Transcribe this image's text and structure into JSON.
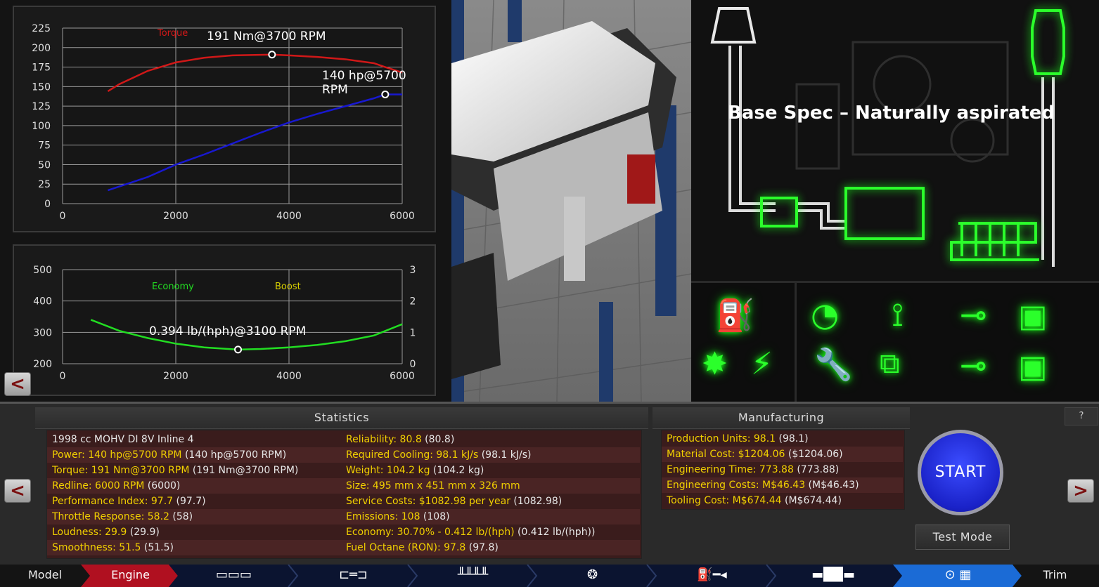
{
  "torque_power_chart": {
    "y_ticks": [
      "225",
      "200",
      "175",
      "150",
      "125",
      "100",
      "75",
      "50",
      "25",
      "0"
    ],
    "x_ticks": [
      "0",
      "2000",
      "4000",
      "6000"
    ],
    "legend_torque": "Torque",
    "peak_torque": "191 Nm@3700 RPM",
    "peak_power": "140 hp@5700 RPM",
    "colors": {
      "torque": "#d01818",
      "power": "#1818d0"
    }
  },
  "economy_chart": {
    "y_left_ticks": [
      "500",
      "400",
      "300",
      "200"
    ],
    "y_right_ticks": [
      "3",
      "2",
      "1",
      "0"
    ],
    "x_ticks": [
      "0",
      "2000",
      "4000",
      "6000"
    ],
    "legend_economy": "Economy",
    "legend_boost": "Boost",
    "best_economy": "0.394 lb/(hph)@3100 RPM",
    "colors": {
      "economy": "#22dd22",
      "boost": "#d8d000"
    }
  },
  "chart_data": [
    {
      "type": "line",
      "title": "",
      "xlabel": "",
      "ylabel": "",
      "xlim": [
        0,
        6000
      ],
      "ylim": [
        0,
        225
      ],
      "grid": true,
      "legend": [
        "Torque"
      ],
      "series": [
        {
          "name": "Torque",
          "x": [
            800,
            1000,
            1500,
            2000,
            2500,
            3000,
            3700,
            4000,
            4500,
            5000,
            5500,
            5700,
            6000
          ],
          "y": [
            144,
            153,
            170,
            181,
            187,
            190,
            191,
            190,
            188,
            185,
            180,
            175,
            168
          ]
        },
        {
          "x": [
            800,
            1500,
            2000,
            2500,
            3000,
            3500,
            4000,
            4500,
            5000,
            5500,
            5700,
            6000
          ],
          "y": [
            17,
            34,
            50,
            63,
            77,
            91,
            104,
            115,
            125,
            135,
            140,
            140
          ]
        }
      ],
      "annotations": [
        "191 Nm@3700 RPM",
        "140 hp@5700 RPM"
      ]
    },
    {
      "type": "line",
      "title": "",
      "xlabel": "",
      "ylabel": "",
      "xlim": [
        0,
        6000
      ],
      "ylim": [
        200,
        500
      ],
      "y2lim": [
        0,
        3
      ],
      "grid": true,
      "legend": [
        "Economy",
        "Boost"
      ],
      "series": [
        {
          "name": "Economy",
          "x": [
            500,
            1000,
            1500,
            2000,
            2500,
            3100,
            3500,
            4000,
            4500,
            5000,
            5500,
            6000
          ],
          "y": [
            340,
            305,
            282,
            264,
            252,
            245,
            247,
            252,
            260,
            272,
            290,
            326
          ]
        }
      ],
      "annotations": [
        "0.394 lb/(hph)@3100 RPM"
      ]
    }
  ],
  "schematic": {
    "title": "Base Spec – Naturally aspirated"
  },
  "statistics": {
    "header": "Statistics",
    "left": [
      {
        "label": "1998 cc MOHV DI 8V Inline 4",
        "value": ""
      },
      {
        "label": "Power: 140 hp@5700 RPM",
        "value": "(140 hp@5700 RPM)"
      },
      {
        "label": "Torque: 191 Nm@3700 RPM",
        "value": "(191 Nm@3700 RPM)"
      },
      {
        "label": "Redline: 6000 RPM",
        "value": "(6000)"
      },
      {
        "label": "Performance Index: 97.7",
        "value": "(97.7)"
      },
      {
        "label": "Throttle Response: 58.2",
        "value": "(58)"
      },
      {
        "label": "Loudness: 29.9",
        "value": "(29.9)"
      },
      {
        "label": "Smoothness: 51.5",
        "value": "(51.5)"
      }
    ],
    "right": [
      {
        "label": "Reliability: 80.8",
        "value": "(80.8)"
      },
      {
        "label": "Required Cooling: 98.1 kJ/s",
        "value": "(98.1 kJ/s)"
      },
      {
        "label": "Weight: 104.2 kg",
        "value": "(104.2 kg)"
      },
      {
        "label": "Size: 495 mm x 451 mm x 326 mm",
        "value": ""
      },
      {
        "label": "Service Costs: $1082.98 per year",
        "value": "(1082.98)"
      },
      {
        "label": "Emissions: 108",
        "value": "(108)"
      },
      {
        "label": "Economy: 30.70% - 0.412 lb/(hph)",
        "value": "(0.412 lb/(hph))"
      },
      {
        "label": "Fuel Octane (RON): 97.8",
        "value": "(97.8)"
      }
    ]
  },
  "manufacturing": {
    "header": "Manufacturing",
    "rows": [
      {
        "label": "Production Units: 98.1",
        "value": "(98.1)"
      },
      {
        "label": "Material Cost: $1204.06",
        "value": "($1204.06)"
      },
      {
        "label": "Engineering Time: 773.88",
        "value": "(773.88)"
      },
      {
        "label": "Engineering Costs: M$46.43",
        "value": "(M$46.43)"
      },
      {
        "label": "Tooling Cost: M$674.44",
        "value": "(M$674.44)"
      }
    ]
  },
  "controls": {
    "start": "START",
    "test_mode": "Test Mode",
    "help": "?",
    "back": "<",
    "forward": ">"
  },
  "nav": {
    "model": "Model",
    "engine": "Engine",
    "trim": "Trim",
    "icons": [
      "engine-block-icon",
      "crankshaft-icon",
      "valvetrain-icon",
      "turbo-icon",
      "fuel-icon",
      "exhaust-icon",
      "tune-icon"
    ]
  }
}
